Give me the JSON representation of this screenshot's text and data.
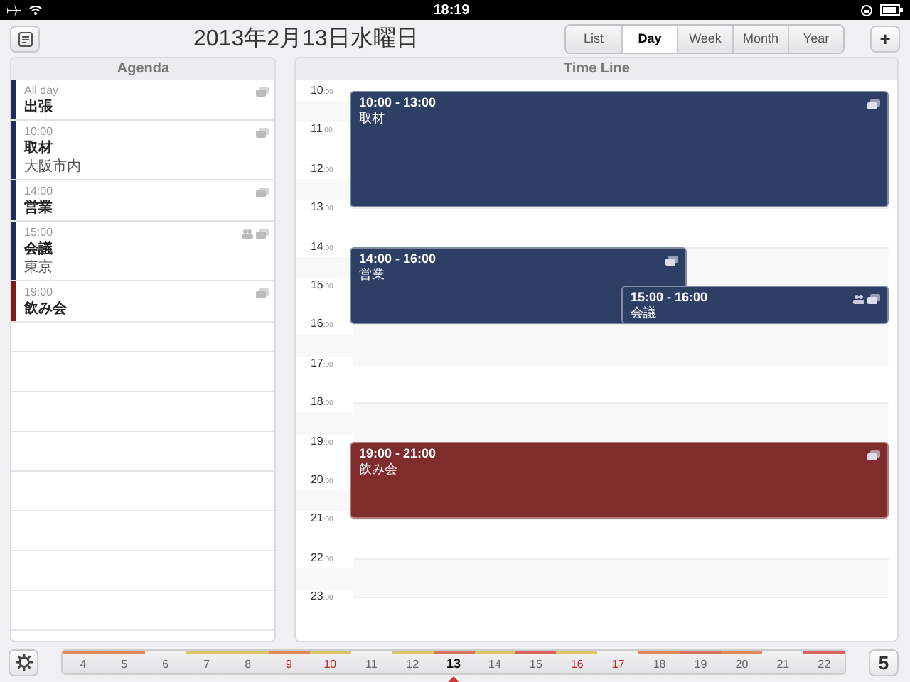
{
  "status_bar": {
    "time": "18:19"
  },
  "toolbar": {
    "title": "2013年2月13日水曜日",
    "views": [
      {
        "label": "List",
        "selected": false
      },
      {
        "label": "Day",
        "selected": true
      },
      {
        "label": "Week",
        "selected": false
      },
      {
        "label": "Month",
        "selected": false
      },
      {
        "label": "Year",
        "selected": false
      }
    ],
    "add_button": "+"
  },
  "agenda": {
    "title": "Agenda",
    "items": [
      {
        "time": "All day",
        "title": "出張",
        "color": "#1f2d5c",
        "invitees": false
      },
      {
        "time": "10:00",
        "title": "取材",
        "location": "大阪市内",
        "color": "#1f2d5c",
        "invitees": false
      },
      {
        "time": "14:00",
        "title": "営業",
        "color": "#1f2d5c",
        "invitees": false
      },
      {
        "time": "15:00",
        "title": "会議",
        "location": "東京",
        "color": "#1f2d5c",
        "invitees": true
      },
      {
        "time": "19:00",
        "title": "飲み会",
        "color": "#7a1c1c",
        "invitees": false
      }
    ]
  },
  "timeline": {
    "title": "Time Line",
    "hours": [
      {
        "hour": "10",
        "minutes": ":00"
      },
      {
        "hour": "11",
        "minutes": ":00"
      },
      {
        "hour": "12",
        "minutes": ":00"
      },
      {
        "hour": "13",
        "minutes": ":00"
      },
      {
        "hour": "14",
        "minutes": ":00"
      },
      {
        "hour": "15",
        "minutes": ":00"
      },
      {
        "hour": "16",
        "minutes": ":00"
      },
      {
        "hour": "17",
        "minutes": ":00"
      },
      {
        "hour": "18",
        "minutes": ":00"
      },
      {
        "hour": "19",
        "minutes": ":00"
      },
      {
        "hour": "20",
        "minutes": ":00"
      },
      {
        "hour": "21",
        "minutes": ":00"
      },
      {
        "hour": "22",
        "minutes": ":00"
      },
      {
        "hour": "23",
        "minutes": ":00"
      }
    ],
    "events": [
      {
        "time": "10:00 - 13:00",
        "title": "取材",
        "kind": "full",
        "color": "#2e3f66",
        "invitees": false
      },
      {
        "time": "14:00 - 16:00",
        "title": "営業",
        "kind": "left",
        "color": "#2e3f66",
        "invitees": false
      },
      {
        "time": "15:00 - 16:00",
        "title": "会議",
        "kind": "right",
        "color": "#2e3f66",
        "invitees": true
      },
      {
        "time": "19:00 - 21:00",
        "title": "飲み会",
        "kind": "full",
        "color": "#802c2c",
        "invitees": false
      }
    ]
  },
  "day_strip": {
    "days": [
      {
        "label": "4",
        "weekend": false,
        "selected": false,
        "color": "#e08a5a"
      },
      {
        "label": "5",
        "weekend": false,
        "selected": false,
        "color": "#e08a5a"
      },
      {
        "label": "6",
        "weekend": false,
        "selected": false
      },
      {
        "label": "7",
        "weekend": false,
        "selected": false,
        "color": "#d9c66a"
      },
      {
        "label": "8",
        "weekend": false,
        "selected": false,
        "color": "#d9c66a"
      },
      {
        "label": "9",
        "weekend": true,
        "selected": false,
        "color": "#e08a5a"
      },
      {
        "label": "10",
        "weekend": true,
        "selected": false,
        "color": "#d9c66a"
      },
      {
        "label": "11",
        "weekend": false,
        "selected": false
      },
      {
        "label": "12",
        "weekend": false,
        "selected": false,
        "color": "#d9c66a"
      },
      {
        "label": "13",
        "weekend": false,
        "selected": true,
        "color": "#d9735a"
      },
      {
        "label": "14",
        "weekend": false,
        "selected": false,
        "color": "#d9c66a"
      },
      {
        "label": "15",
        "weekend": false,
        "selected": false,
        "color": "#d9625a"
      },
      {
        "label": "16",
        "weekend": true,
        "selected": false,
        "color": "#d9c66a"
      },
      {
        "label": "17",
        "weekend": true,
        "selected": false
      },
      {
        "label": "18",
        "weekend": false,
        "selected": false,
        "color": "#e08a5a"
      },
      {
        "label": "19",
        "weekend": false,
        "selected": false,
        "color": "#d9735a"
      },
      {
        "label": "20",
        "weekend": false,
        "selected": false,
        "color": "#e08a5a"
      },
      {
        "label": "21",
        "weekend": false,
        "selected": false
      },
      {
        "label": "22",
        "weekend": false,
        "selected": false,
        "color": "#d9625a"
      }
    ],
    "count_button": "5"
  }
}
